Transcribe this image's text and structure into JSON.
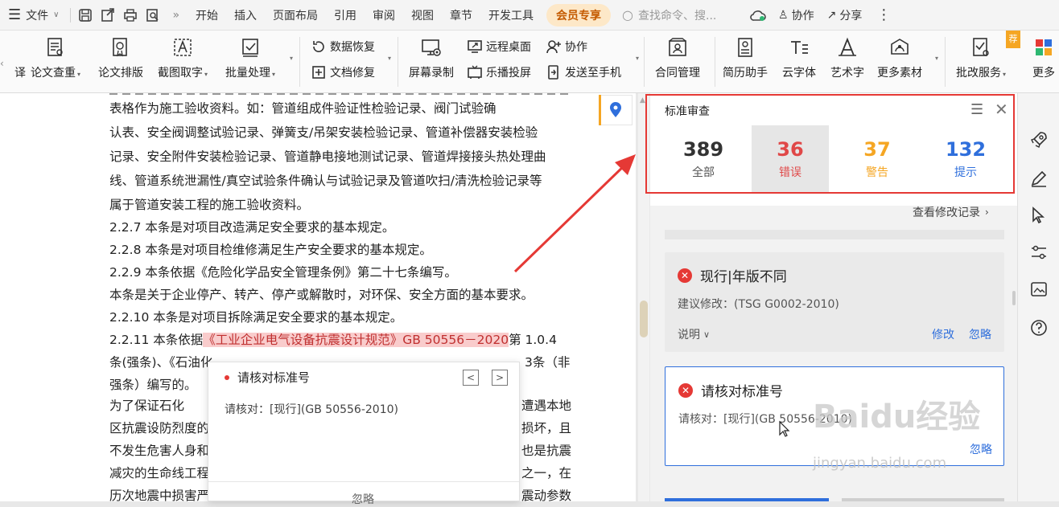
{
  "menubar": {
    "file_label": "文件",
    "more_glyph": "»",
    "tabs": [
      "开始",
      "插入",
      "页面布局",
      "引用",
      "审阅",
      "视图",
      "章节",
      "开发工具"
    ],
    "vip_tab": "会员专享",
    "search_placeholder": "查找命令、搜...",
    "cooperate": "协作",
    "share": "分享"
  },
  "ribbon": {
    "translate": "译",
    "paper_check": "论文查重",
    "paper_layout": "论文排版",
    "ocr": "截图取字",
    "batch": "批量处理",
    "data_recover": "数据恢复",
    "doc_repair": "文档修复",
    "screen_record": "屏幕录制",
    "remote_desktop": "远程桌面",
    "cooperate": "协作",
    "cast": "乐播投屏",
    "send_phone": "发送至手机",
    "contract": "合同管理",
    "resume": "简历助手",
    "cloud_font": "云字体",
    "art_text": "艺术字",
    "more_material": "更多素材",
    "correction": "批改服务",
    "more": "更多",
    "badge": "荐"
  },
  "document": {
    "lines": [
      "表格作为施工验收资料。如：管道组成件验证性检验记录、阀门试验确",
      "认表、安全阀调整试验记录、弹簧支/吊架安装检验记录、管道补偿器安装检验",
      "记录、安全附件安装检验记录、管道静电接地测试记录、管道焊接接头热处理曲",
      "线、管道系统泄漏性/真空试验条件确认与试验记录及管道吹扫/清洗检验记录等",
      "属于管道安装工程的施工验收资料。",
      "2.2.7   本条是对项目改造满足安全要求的基本规定。",
      "2.2.8   本条是对项目检维修满足生产安全要求的基本规定。",
      "2.2.9   本条依据《危险化学品安全管理条例》第二十七条编写。",
      "        本条是关于企业停产、转产、停产或解散时，对环保、安全方面的基本要求。",
      "2.2.10  本条是对项目拆除满足安全要求的基本规定。"
    ],
    "line_2211_pre": "2.2.11 本条依据",
    "line_2211_hl": "《工业企业电气设备抗震设计规范》GB 50556－2020",
    "line_2211_post": "第 1.0.4",
    "line_12_left": "条(强条)、《石油化",
    "line_12_right": "3条（非",
    "line_13": "强条）编写的。",
    "left_frag": [
      "        为了保证石化",
      "区抗震设防烈度的",
      "不发生危害人身和",
      "减灾的生命线工程",
      "历次地震中损害严"
    ],
    "right_frag": [
      "遭遇本地",
      "损坏，且",
      "也是抗震",
      "之一，在",
      "震动参数"
    ]
  },
  "popup": {
    "title": "请核对标准号",
    "prev": "<",
    "next": ">",
    "body": "请核对：[现行](GB 50556-2010)",
    "ignore": "忽略"
  },
  "panel": {
    "title": "标准审查",
    "stats": [
      {
        "num": "389",
        "label": "全部",
        "color": "#333333"
      },
      {
        "num": "36",
        "label": "错误",
        "color": "#e04848"
      },
      {
        "num": "37",
        "label": "警告",
        "color": "#f5a623"
      },
      {
        "num": "132",
        "label": "提示",
        "color": "#2f6fdc"
      }
    ],
    "history_link": "查看修改记录",
    "card1": {
      "title": "现行|年版不同",
      "suggest": "建议修改：(TSG G0002-2010)",
      "explain": "说明",
      "modify": "修改",
      "ignore": "忽略"
    },
    "card2": {
      "title": "请核对标准号",
      "body": "请核对：[现行](GB 50556-2010)",
      "ignore": "忽略"
    }
  },
  "watermark": {
    "brand": "Baidu经验",
    "url": "jingyan.baidu.com"
  },
  "colors": {
    "accent_red": "#e53935",
    "link_blue": "#2f6fdc"
  }
}
